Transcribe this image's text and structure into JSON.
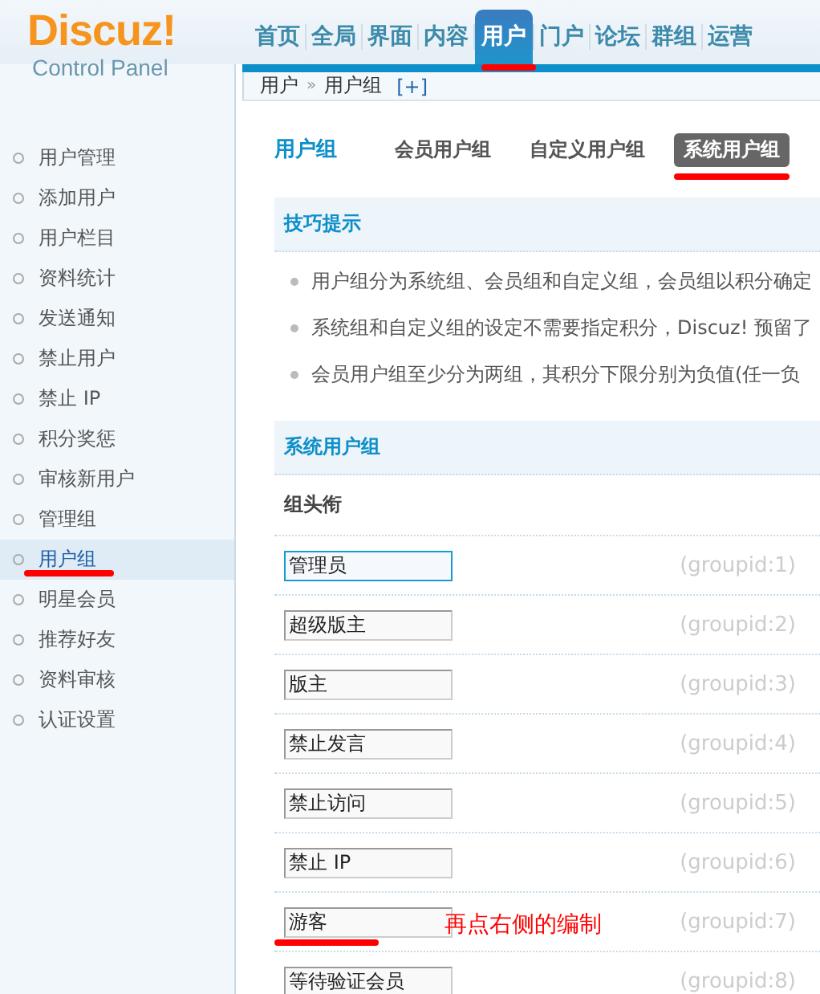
{
  "logo": {
    "title": "Discuz!",
    "subtitle": "Control Panel"
  },
  "nav": [
    {
      "label": "首页",
      "selected": false,
      "marked": false
    },
    {
      "label": "全局",
      "selected": false,
      "marked": false
    },
    {
      "label": "界面",
      "selected": false,
      "marked": false
    },
    {
      "label": "内容",
      "selected": false,
      "marked": false
    },
    {
      "label": "用户",
      "selected": true,
      "marked": true
    },
    {
      "label": "门户",
      "selected": false,
      "marked": false
    },
    {
      "label": "论坛",
      "selected": false,
      "marked": false
    },
    {
      "label": "群组",
      "selected": false,
      "marked": false
    },
    {
      "label": "运营",
      "selected": false,
      "marked": false
    }
  ],
  "breadcrumb": {
    "parts": [
      "用户",
      "用户组"
    ],
    "separator": "»",
    "add": "[+]"
  },
  "sidebar": {
    "items": [
      {
        "label": "用户管理",
        "selected": false,
        "marked": false
      },
      {
        "label": "添加用户",
        "selected": false,
        "marked": false
      },
      {
        "label": "用户栏目",
        "selected": false,
        "marked": false
      },
      {
        "label": "资料统计",
        "selected": false,
        "marked": false
      },
      {
        "label": "发送通知",
        "selected": false,
        "marked": false
      },
      {
        "label": "禁止用户",
        "selected": false,
        "marked": false
      },
      {
        "label": "禁止 IP",
        "selected": false,
        "marked": false
      },
      {
        "label": "积分奖惩",
        "selected": false,
        "marked": false
      },
      {
        "label": "审核新用户",
        "selected": false,
        "marked": false
      },
      {
        "label": "管理组",
        "selected": false,
        "marked": false
      },
      {
        "label": "用户组",
        "selected": true,
        "marked": true
      },
      {
        "label": "明星会员",
        "selected": false,
        "marked": false
      },
      {
        "label": "推荐好友",
        "selected": false,
        "marked": false
      },
      {
        "label": "资料审核",
        "selected": false,
        "marked": false
      },
      {
        "label": "认证设置",
        "selected": false,
        "marked": false
      }
    ]
  },
  "page": {
    "title": "用户组",
    "tabs": [
      {
        "label": "会员用户组",
        "selected": false,
        "marked": false
      },
      {
        "label": "自定义用户组",
        "selected": false,
        "marked": false
      },
      {
        "label": "系统用户组",
        "selected": true,
        "marked": true
      }
    ]
  },
  "tips": {
    "title": "技巧提示",
    "items": [
      "用户组分为系统组、会员组和自定义组，会员组以积分确定",
      "系统组和自定义组的设定不需要指定积分，Discuz! 预留了",
      "会员用户组至少分为两组，其积分下限分别为负值(任一负"
    ]
  },
  "groups": {
    "title": "系统用户组",
    "column": "组头衔",
    "rows": [
      {
        "value": "管理员",
        "id": "(groupid:1)",
        "focused": true,
        "marked": false
      },
      {
        "value": "超级版主",
        "id": "(groupid:2)",
        "focused": false,
        "marked": false
      },
      {
        "value": "版主",
        "id": "(groupid:3)",
        "focused": false,
        "marked": false
      },
      {
        "value": "禁止发言",
        "id": "(groupid:4)",
        "focused": false,
        "marked": false
      },
      {
        "value": "禁止访问",
        "id": "(groupid:5)",
        "focused": false,
        "marked": false
      },
      {
        "value": "禁止 IP",
        "id": "(groupid:6)",
        "focused": false,
        "marked": false
      },
      {
        "value": "游客",
        "id": "(groupid:7)",
        "focused": false,
        "marked": true,
        "note": "再点右侧的编制"
      },
      {
        "value": "等待验证会员",
        "id": "(groupid:8)",
        "focused": false,
        "marked": false
      }
    ]
  }
}
